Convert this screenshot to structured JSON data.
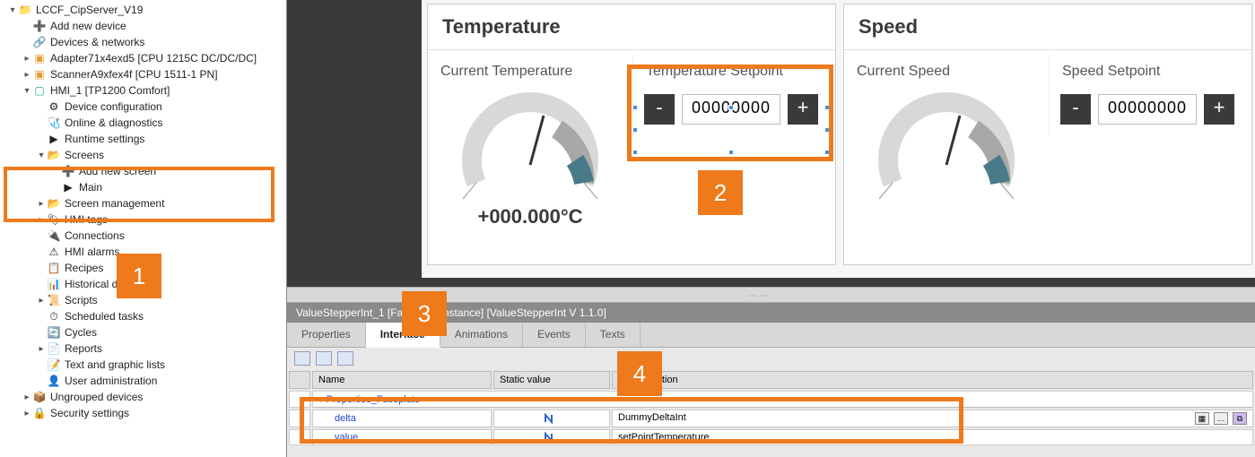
{
  "tree": {
    "project": "LCCF_CipServer_V19",
    "add_device": "Add new device",
    "devices_networks": "Devices & networks",
    "adapter": "Adapter71x4exd5 [CPU 1215C DC/DC/DC]",
    "scanner": "ScannerA9xfex4f [CPU 1511-1 PN]",
    "hmi": "HMI_1 [TP1200 Comfort]",
    "device_cfg": "Device configuration",
    "online_diag": "Online & diagnostics",
    "runtime": "Runtime settings",
    "screens": "Screens",
    "add_screen": "Add new screen",
    "main_screen": "Main",
    "screen_mgmt": "Screen management",
    "hmi_tags": "HMI tags",
    "connections": "Connections",
    "alarms": "HMI alarms",
    "recipes": "Recipes",
    "historical": "Historical data",
    "scripts": "Scripts",
    "scheduled": "Scheduled tasks",
    "cycles": "Cycles",
    "reports": "Reports",
    "textgfx": "Text and graphic lists",
    "useradmin": "User administration",
    "ungrouped": "Ungrouped devices",
    "security": "Security settings"
  },
  "hmi": {
    "temp": {
      "title": "Temperature",
      "current_label": "Current Temperature",
      "current_value": "+000.000°C",
      "setpoint_label": "Temperature Setpoint",
      "setpoint_value": "00000000",
      "minus": "-",
      "plus": "+"
    },
    "speed": {
      "title": "Speed",
      "current_label": "Current Speed",
      "setpoint_label": "Speed Setpoint",
      "setpoint_value": "00000000",
      "minus": "-",
      "plus": "+"
    }
  },
  "props": {
    "title": "ValueStepperInt_1 [Faceplate instance] [ValueStepperInt V 1.1.0]",
    "tabs": {
      "properties": "Properties",
      "interface": "Interface",
      "animations": "Animations",
      "events": "Events",
      "texts": "Texts"
    },
    "cols": {
      "name": "Name",
      "static": "Static value",
      "dyn": "Dynamization"
    },
    "group": "Properties_Faceplate",
    "rows": [
      {
        "name": "delta",
        "dyn": "DummyDeltaInt"
      },
      {
        "name": "value",
        "dyn": "setPointTemperature"
      }
    ]
  },
  "callouts": {
    "c1": "1",
    "c2": "2",
    "c3": "3",
    "c4": "4"
  }
}
